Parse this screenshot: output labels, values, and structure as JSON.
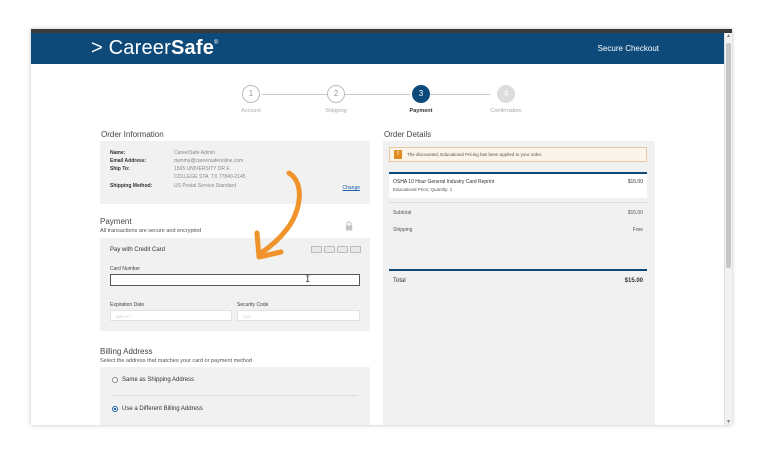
{
  "header": {
    "logo_prefix": "> Career",
    "logo_bold": "Safe",
    "logo_mark": "®",
    "secure_checkout": "Secure Checkout"
  },
  "steps": [
    {
      "number": "1",
      "label": "Account"
    },
    {
      "number": "2",
      "label": "Shipping"
    },
    {
      "number": "3",
      "label": "Payment"
    },
    {
      "number": "4",
      "label": "Confirmation"
    }
  ],
  "order_information": {
    "title": "Order Information",
    "name_label": "Name:",
    "name_value": "CareerSafe Admin",
    "email_label": "Email Address:",
    "email_value": "dummy@careersafeonline.com",
    "ship_label": "Ship To:",
    "ship_line1": "1565 UNIVERSITY DR E",
    "ship_line2": "COLLEGE STA, TX 77840-2145",
    "method_label": "Shipping Method:",
    "method_value": "US Postal Service Standard",
    "change_link": "Change"
  },
  "payment": {
    "title": "Payment",
    "subtitle": "All transactions are secure and encrypted",
    "pay_with": "Pay with Credit Card",
    "card_number_label": "Card Number",
    "card_number_value": "",
    "expiration_label": "Expiration Date",
    "expiration_placeholder": "MM / YY",
    "security_label": "Security Code",
    "security_placeholder": "CVV"
  },
  "billing": {
    "title": "Billing Address",
    "subtitle": "Select the address that matches your card or payment method",
    "option_same": "Same as Shipping Address",
    "option_different": "Use a Different Billing Address",
    "selected": "option_different"
  },
  "order_details": {
    "title": "Order Details",
    "notice": "The discounted, Educational Pricing has been applied to your order.",
    "item_name": "OSHA 10 Hour General Industry Card Reprint",
    "item_sub": "Educational Price; Quantity: 1",
    "item_price": "$15.00",
    "subtotal_label": "Subtotal",
    "subtotal_value": "$15.00",
    "shipping_label": "Shipping",
    "shipping_value": "Free",
    "total_label": "Total",
    "total_value": "$15.00"
  },
  "colors": {
    "brand_blue": "#0d4a7a",
    "arrow_orange": "#f0932b",
    "notice_orange": "#e38a1f"
  },
  "icons": [
    "lock-icon",
    "visa-card-icon",
    "mastercard-icon",
    "amex-card-icon",
    "discover-card-icon",
    "warning-icon",
    "annotation-arrow"
  ]
}
